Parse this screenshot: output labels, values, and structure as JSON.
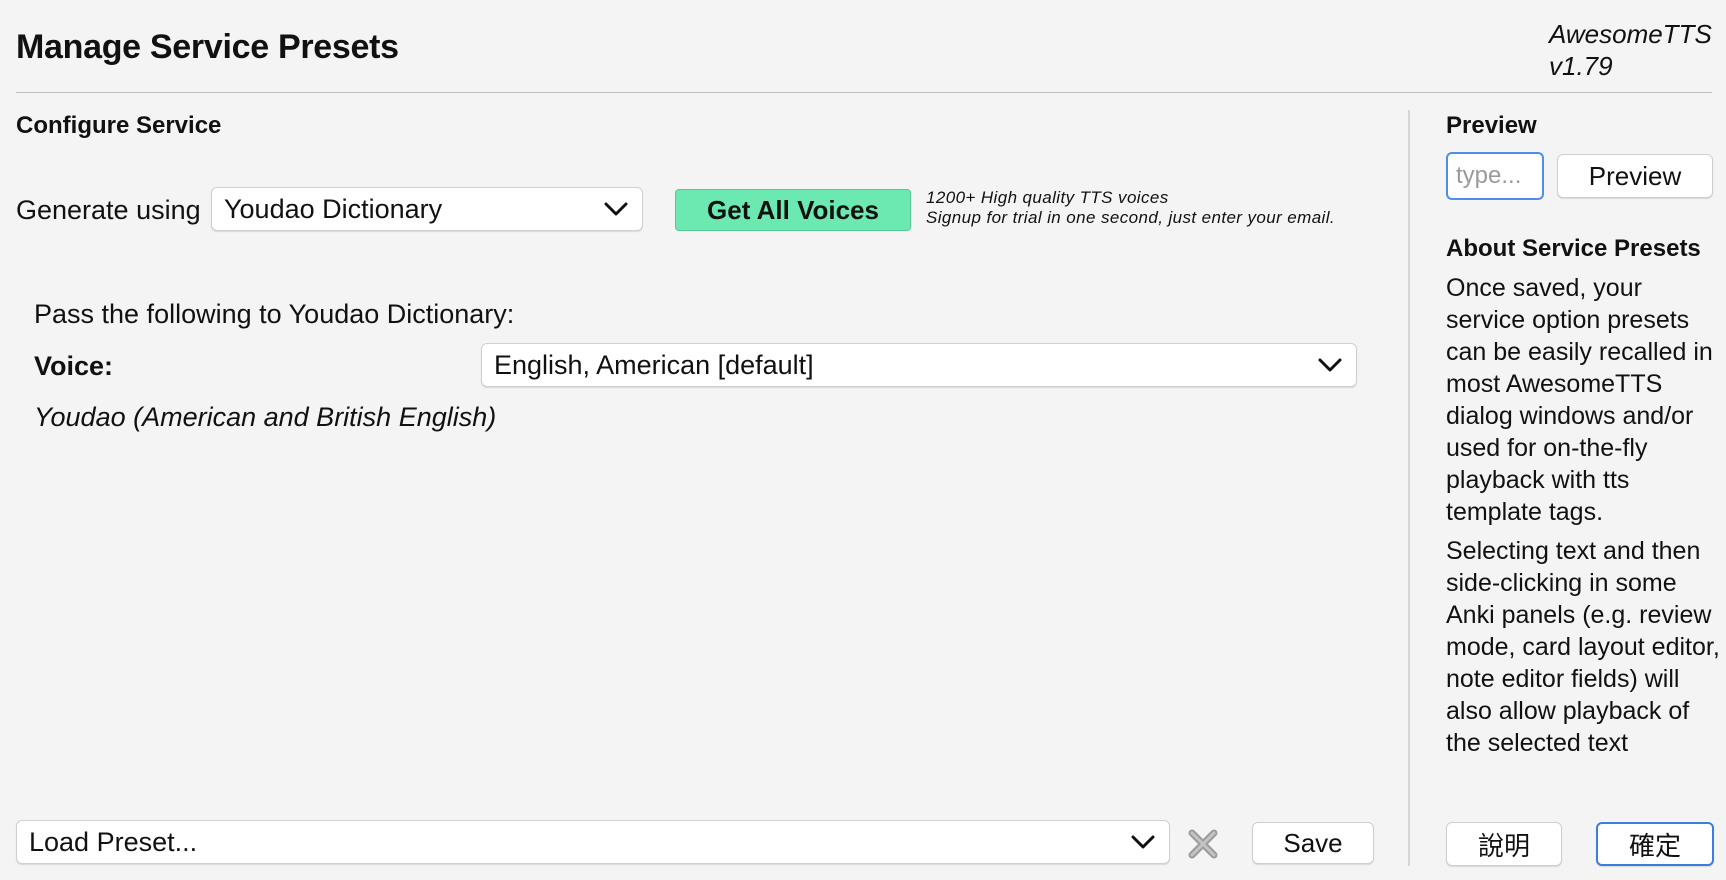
{
  "header": {
    "title": "Manage Service Presets",
    "version_name": "AwesomeTTS",
    "version_number": "v1.79"
  },
  "configure": {
    "section_title": "Configure Service",
    "generate_label": "Generate using",
    "service_selected": "Youdao Dictionary",
    "get_voices_label": "Get All Voices",
    "promo_line1": "1200+ High quality TTS voices",
    "promo_line2": "Signup for trial in one second, just enter your email.",
    "pass_text": "Pass the following to Youdao Dictionary:",
    "voice_label": "Voice:",
    "voice_selected": "English, American [default]",
    "service_note": "Youdao (American and British English)"
  },
  "presets": {
    "load_placeholder": "Load Preset...",
    "save_label": "Save"
  },
  "preview": {
    "section_title": "Preview",
    "input_placeholder": "type...",
    "button_label": "Preview"
  },
  "about": {
    "section_title": "About Service Presets",
    "paragraph1": "Once saved, your service option presets can be easily recalled in most AwesomeTTS dialog windows and/or used for on-the-fly playback with tts template tags.",
    "paragraph2": "Selecting text and then side-clicking in some Anki panels (e.g. review mode, card layout editor, note editor fields) will also allow playback of the selected text"
  },
  "footer": {
    "help_label": "說明",
    "ok_label": "確定"
  },
  "colors": {
    "accent_green": "#6ce9b0",
    "focus_blue": "#4d8ee8",
    "background": "#f4f4f4"
  },
  "icons": {
    "dropdown": "chevron-down-icon",
    "clear": "clear-x-icon"
  }
}
